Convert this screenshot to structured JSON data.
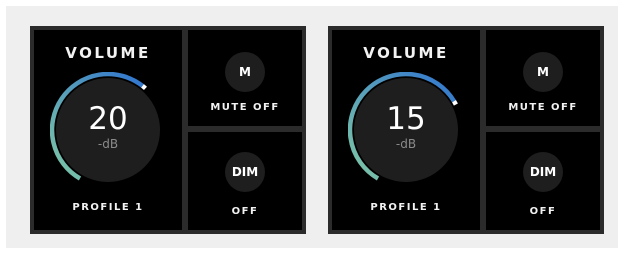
{
  "panels": [
    {
      "volume_title": "VOLUME",
      "volume_value": "20",
      "volume_unit": "-dB",
      "volume_level": 0.64,
      "profile_label": "PROFILE 1",
      "mute_button": "M",
      "mute_status": "MUTE OFF",
      "dim_button": "DIM",
      "dim_status": "OFF"
    },
    {
      "volume_title": "VOLUME",
      "volume_value": "15",
      "volume_unit": "-dB",
      "volume_level": 0.71,
      "profile_label": "PROFILE 1",
      "mute_button": "M",
      "mute_status": "MUTE OFF",
      "dim_button": "DIM",
      "dim_status": "OFF"
    }
  ],
  "colors": {
    "arc_start": "#7fc8a5",
    "arc_end": "#2f74d0",
    "knob_face": "#1e1e1e",
    "indicator": "#ffffff"
  }
}
